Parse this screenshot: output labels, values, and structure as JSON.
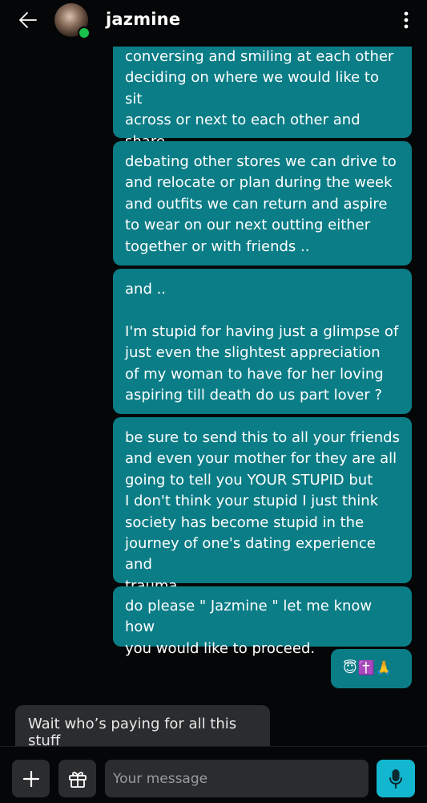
{
  "header": {
    "title": "jazmine",
    "back_icon": "arrow-left-icon",
    "more_icon": "kebab-menu-icon",
    "online_color": "#19c24a"
  },
  "messages": [
    {
      "direction": "outgoing",
      "text": "conversing and smiling at each other\ndeciding on where we would like to sit\nacross or next to each other and share\nlunch together."
    },
    {
      "direction": "outgoing",
      "text": "debating other stores we can drive to\nand relocate or plan during the week\nand outfits we can return and aspire\nto wear on our next outting either\ntogether or with friends .."
    },
    {
      "direction": "outgoing",
      "text": "and ..\n\nI'm stupid for having just a glimpse of\njust even the slightest appreciation\nof my woman to have for her loving\naspiring till death do us part lover ?"
    },
    {
      "direction": "outgoing",
      "text": "be sure to send this to all your friends\nand even your mother for they are all\ngoing to tell you YOUR STUPID but\nI don't think your stupid I just think\nsociety has become stupid in the\njourney of one's dating experience and\ntrauma."
    },
    {
      "direction": "outgoing",
      "text": "do please \" Jazmine \" let me know how\nyou would like to proceed."
    },
    {
      "direction": "outgoing",
      "text": "😇✝️🙏"
    },
    {
      "direction": "incoming",
      "text": "Wait who’s paying for all this stuff"
    }
  ],
  "composer": {
    "placeholder": "Your message",
    "add_icon": "plus-icon",
    "gift_icon": "gift-icon",
    "mic_icon": "microphone-icon"
  },
  "colors": {
    "outgoing_bubble": "#0b7d87",
    "incoming_bubble": "#2b2c2e",
    "background": "#050607",
    "mic_button": "#13b6cf"
  }
}
